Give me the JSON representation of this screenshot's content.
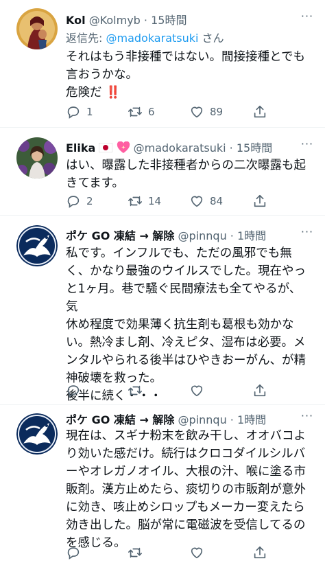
{
  "tweets": [
    {
      "name": "Kol",
      "handle": "@Kolmyb",
      "time": "15時間",
      "reply_label": "返信先: ",
      "reply_mention": "@madokaratsuki",
      "reply_suffix": " さん",
      "lines": [
        "それはもう非接種ではない。間接接種とでも",
        "言おうかな。",
        "危険だ ‼️"
      ],
      "replies": "1",
      "retweets": "6",
      "likes": "89"
    },
    {
      "name": "Elika",
      "handle": "@madokaratsuki",
      "time": "15時間",
      "lines": [
        "はい、曝露した非接種者からの二次曝露も起",
        "きてます。"
      ],
      "replies": "2",
      "retweets": "14",
      "likes": "84"
    },
    {
      "name": "ポケ GO 凍結 → 解除",
      "handle": "@pinnqu",
      "time": "1時間",
      "lines": [
        "私です。インフルでも、ただの風邪でも無",
        "く、かなり最強のウイルスでした。現在やっ",
        "と1ヶ月。巷で騒ぐ民間療法も全てやるが、気",
        "休め程度で効果薄く抗生剤も葛根も効かな",
        "い。熱冷まし剤、冷えピタ、湿布は必要。メ",
        "ンタルやられる後半はひやきおーがん、が精",
        "神破壊を救った。",
        "後半に続く・・・"
      ],
      "replies": "",
      "retweets": "",
      "likes": ""
    },
    {
      "name": "ポケ GO 凍結 → 解除",
      "handle": "@pinnqu",
      "time": "1時間",
      "lines": [
        "現在は、スギナ粉末を飲み干し、オオバコよ",
        "り効いた感だけ。続行はクロコダイルシルバ",
        "ーやオレガノオイル、大根の汁、喉に塗る市",
        "販剤。漢方止めたら、痰切りの市販剤が意外",
        "に効き、咳止めシロップもメーカー変えたら",
        "効き出した。脳が常に電磁波を受信してるの",
        "を感じる。"
      ],
      "replies": "",
      "retweets": "",
      "likes": ""
    }
  ],
  "icons": {
    "reply": "reply-icon",
    "retweet": "retweet-icon",
    "like": "like-icon",
    "share": "share-icon",
    "more": "more-icon"
  },
  "colors": {
    "link": "#1d9bf0",
    "secondary": "#536471",
    "text": "#0f1419",
    "divider": "#eff3f4"
  }
}
